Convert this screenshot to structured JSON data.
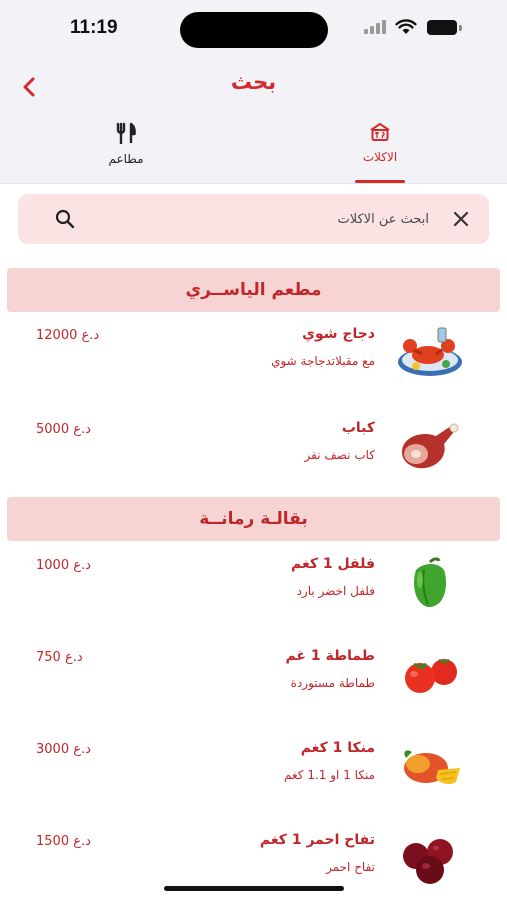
{
  "status_bar": {
    "time": "11:19"
  },
  "header": {
    "title": "بحث"
  },
  "tabs": [
    {
      "label": "الاكلات",
      "icon": "restaurant-building-icon",
      "selected": true
    },
    {
      "label": "مطاعم",
      "icon": "fork-knife-icon",
      "selected": false
    }
  ],
  "search": {
    "placeholder": "ابحث عن الاكلات",
    "value": ""
  },
  "colors": {
    "accent": "#d42a2a",
    "section_bg": "#f6d4d4",
    "search_bg": "#fbe3e3",
    "header_bg": "#f3f2f7"
  },
  "sections": [
    {
      "title": "مطعم الياســري",
      "items": [
        {
          "name": "دجاج شوي",
          "description": "مع مقبلاتدجاجة شوي",
          "price": "د.ع 12000",
          "image": "lobster-plate-icon"
        },
        {
          "name": "كباب",
          "description": "كاب نصف نفر",
          "price": "د.ع 5000",
          "image": "ham-leg-icon"
        }
      ]
    },
    {
      "title": "بقالـة رمانــة",
      "items": [
        {
          "name": "فلفل 1 كغم",
          "description": "فلفل اخضر بارد",
          "price": "د.ع 1000",
          "image": "green-pepper-icon"
        },
        {
          "name": "طماطة 1 غم",
          "description": "طماطة مستوردة",
          "price": "د.ع 750",
          "image": "tomatoes-icon"
        },
        {
          "name": "منكا 1 كغم",
          "description": "منكا 1 او 1.1 كغم",
          "price": "د.ع 3000",
          "image": "mango-icon"
        },
        {
          "name": "تفاح احمر 1 كغم",
          "description": "تفاح احمر",
          "price": "د.ع 1500",
          "image": "red-apples-icon"
        }
      ]
    }
  ]
}
